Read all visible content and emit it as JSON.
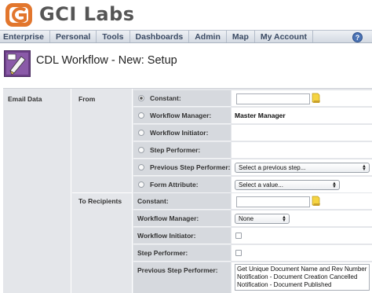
{
  "brand": {
    "name": "GCI Labs",
    "logo_color": "#e2762d"
  },
  "nav": {
    "items": [
      "Enterprise",
      "Personal",
      "Tools",
      "Dashboards",
      "Admin",
      "Map",
      "My Account"
    ],
    "help_icon": "help-icon"
  },
  "page": {
    "title": "CDL Workflow - New: Setup",
    "icon": "workflow-icon"
  },
  "form": {
    "section_label": "Email Data",
    "from": {
      "label": "From",
      "rows": [
        {
          "label": "Constant:",
          "selected": true
        },
        {
          "label": "Workflow Manager:",
          "value": "Master Manager"
        },
        {
          "label": "Workflow Initiator:"
        },
        {
          "label": "Step Performer:"
        },
        {
          "label": "Previous Step Performer:",
          "select": "Select a previous step..."
        },
        {
          "label": "Form Attribute:",
          "select": "Select a value..."
        }
      ]
    },
    "to": {
      "label": "To Recipients",
      "rows": [
        {
          "label": "Constant:"
        },
        {
          "label": "Workflow Manager:",
          "select": "None"
        },
        {
          "label": "Workflow Initiator:"
        },
        {
          "label": "Step Performer:"
        },
        {
          "label": "Previous Step Performer:",
          "list": [
            "Get Unique Document Name and Rev Number",
            "Notification - Document Creation Cancelled",
            "Notification - Document Published"
          ]
        }
      ]
    }
  }
}
